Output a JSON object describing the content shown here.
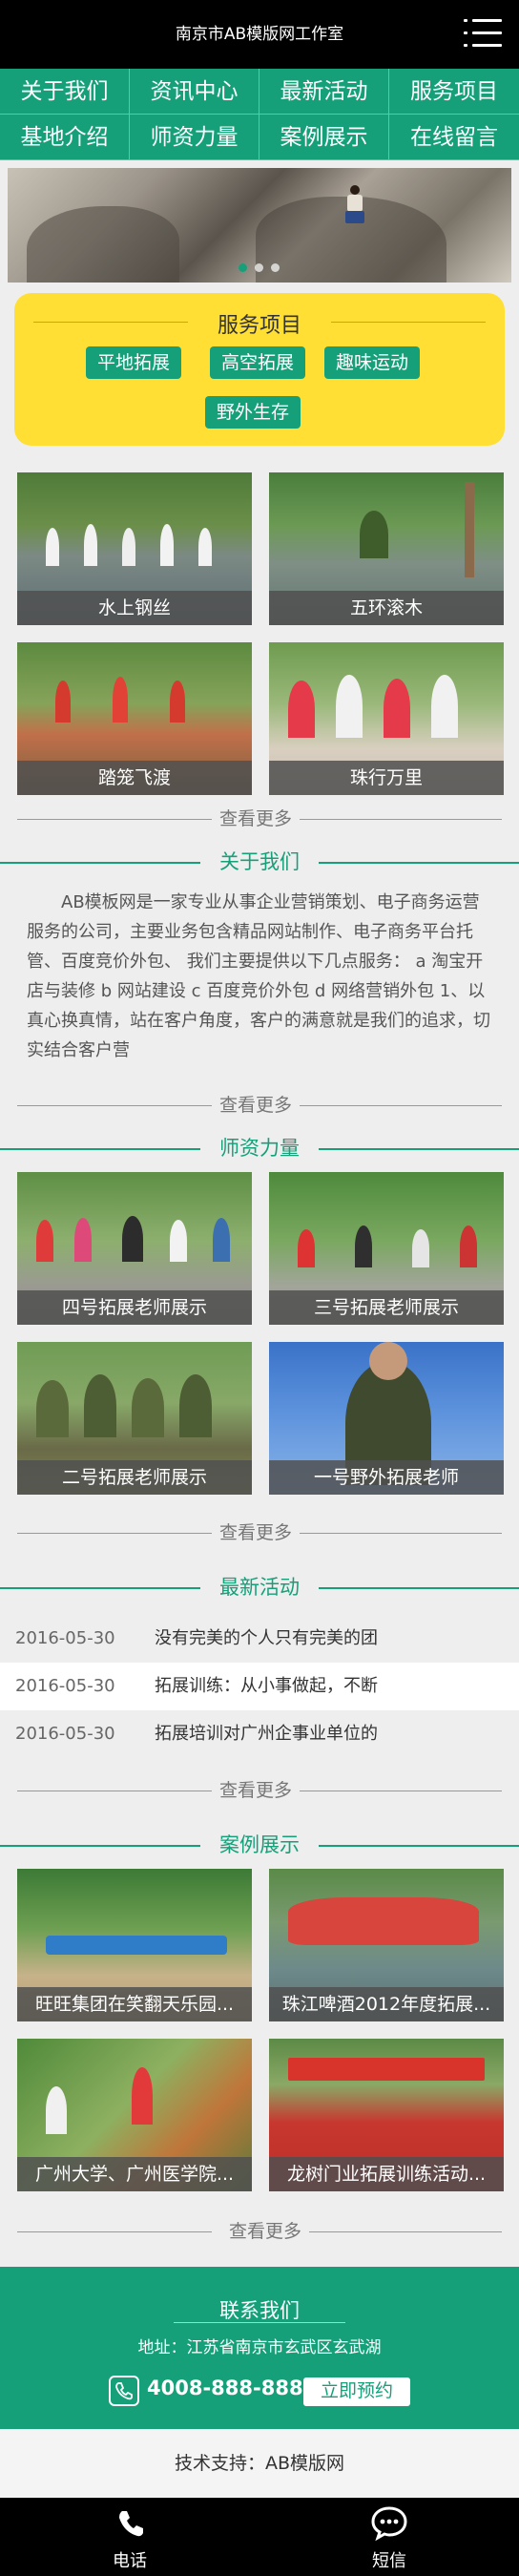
{
  "header": {
    "title": "南京市AB模版网工作室",
    "menu_icon": "hamburger-icon"
  },
  "nav": {
    "items": [
      "关于我们",
      "资讯中心",
      "最新活动",
      "服务项目",
      "基地介绍",
      "师资力量",
      "案例展示",
      "在线留言"
    ]
  },
  "banner": {
    "slide_count": 3,
    "active_index": 0
  },
  "services": {
    "title": "服务项目",
    "buttons": [
      "平地拓展",
      "高空拓展",
      "趣味运动",
      "野外生存"
    ]
  },
  "service_tiles": [
    "水上钢丝",
    "五环滚木",
    "踏笼飞渡",
    "珠行万里"
  ],
  "more_label": "查看更多",
  "about": {
    "title": "关于我们",
    "text": "AB模板网是一家专业从事企业营销策划、电子商务运营服务的公司，主要业务包含精品网站制作、电子商务平台托管、百度竞价外包、 我们主要提供以下几点服务： a 淘宝开店与装修 b 网站建设 c 百度竞价外包 d 网络营销外包 1、以真心换真情，站在客户角度，客户的满意就是我们的追求，切实结合客户营"
  },
  "teachers": {
    "title": "师资力量",
    "items": [
      "四号拓展老师展示",
      "三号拓展老师展示",
      "二号拓展老师展示",
      "一号野外拓展老师"
    ]
  },
  "news": {
    "title": "最新活动",
    "items": [
      {
        "date": "2016-05-30",
        "title": "没有完美的个人只有完美的团"
      },
      {
        "date": "2016-05-30",
        "title": "拓展训练：从小事做起，不断"
      },
      {
        "date": "2016-05-30",
        "title": "拓展培训对广州企事业单位的"
      }
    ]
  },
  "cases": {
    "title": "案例展示",
    "items": [
      "旺旺集团在笑翻天乐园...",
      "珠江啤酒2012年度拓展...",
      "广州大学、广州医学院...",
      "龙树门业拓展训练活动..."
    ]
  },
  "contact": {
    "title": "联系我们",
    "address": "地址：江苏省南京市玄武区玄武湖",
    "phone": "4008-888-888",
    "book_label": "立即预约"
  },
  "footer": {
    "support": "技术支持：AB模版网"
  },
  "bottombar": {
    "phone_label": "电话",
    "sms_label": "短信"
  },
  "colors": {
    "brand_green": "#16a07a",
    "service_yellow": "#ffdf33",
    "header_black": "#000000"
  }
}
